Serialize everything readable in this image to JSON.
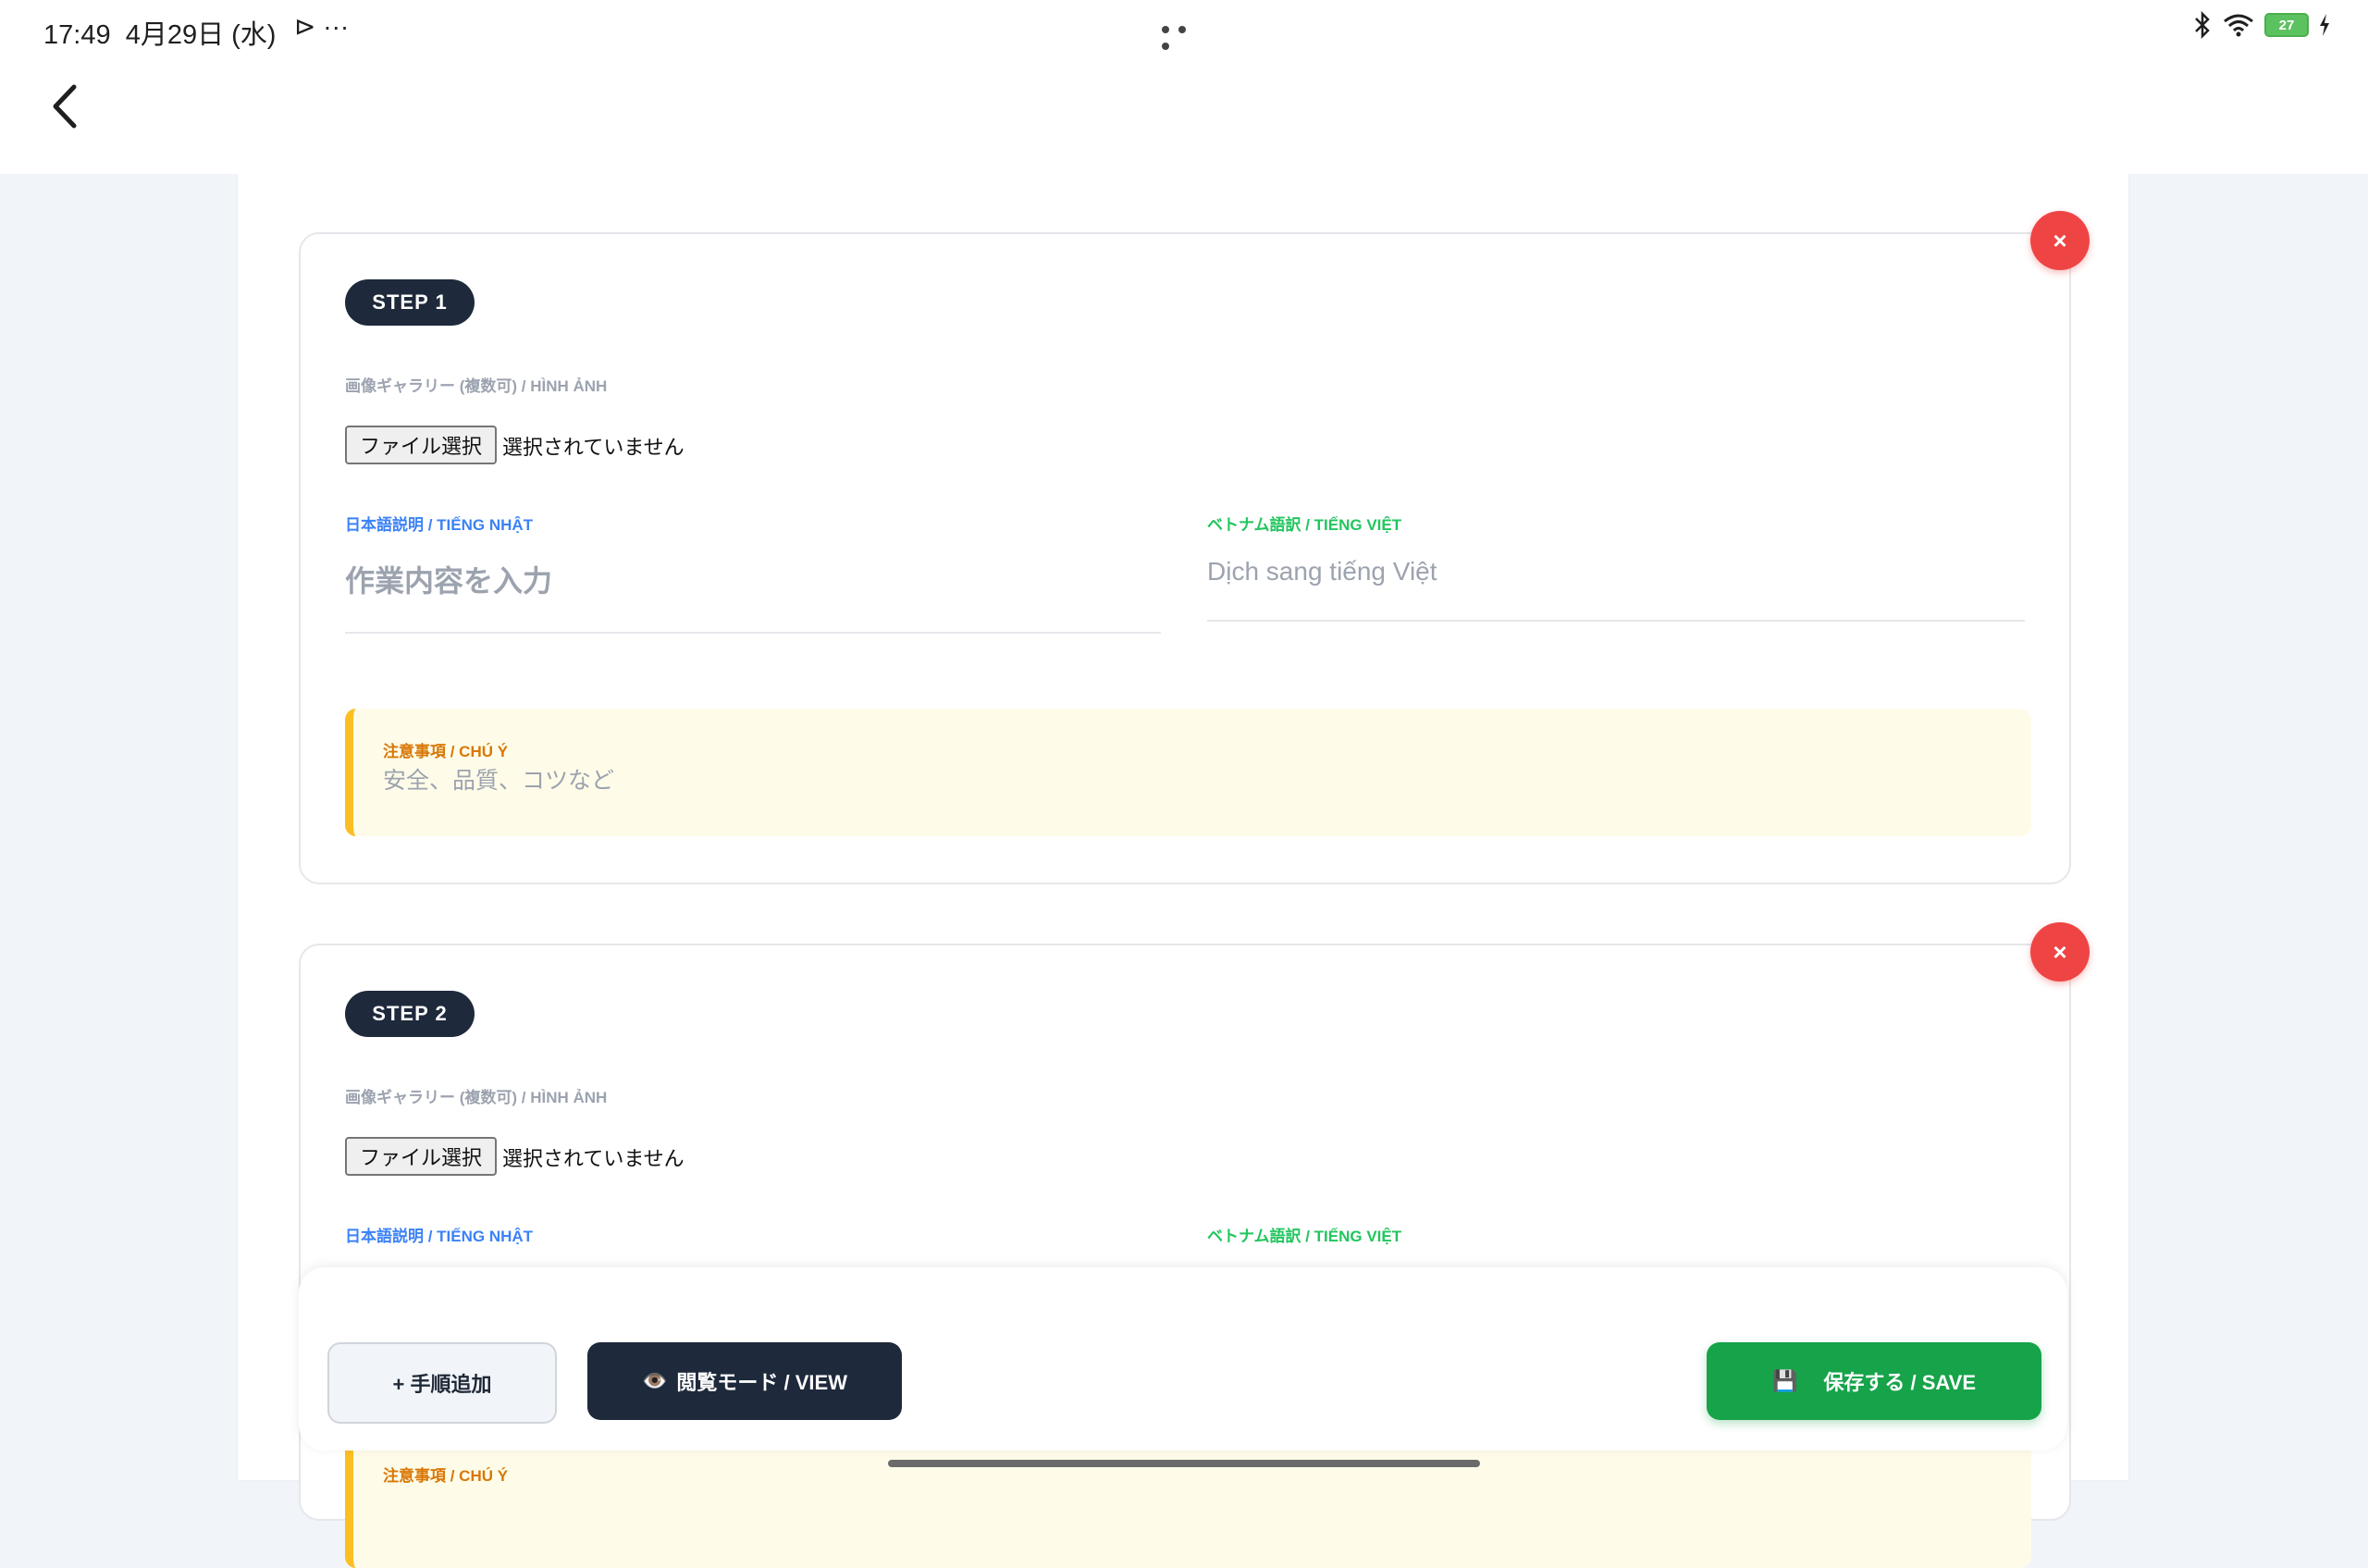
{
  "status_bar": {
    "time": "17:49",
    "date": "4月29日 (水)",
    "left_icons": "⊳ ···",
    "battery": "27"
  },
  "steps": [
    {
      "badge": "STEP 1",
      "gallery_label": "画像ギャラリー (複数可) / HÌNH ẢNH",
      "file_button": "ファイル選択",
      "file_status": "選択されていません",
      "jp_label": "日本語説明 / TIẾNG NHẬT",
      "jp_placeholder": "作業内容を入力",
      "vn_label": "ベトナム語訳 / TIẾNG VIỆT",
      "vn_placeholder": "Dịch sang tiếng Việt",
      "note_label": "注意事項 / CHÚ Ý",
      "note_placeholder": "安全、品質、コツなど",
      "close": "×"
    },
    {
      "badge": "STEP 2",
      "gallery_label": "画像ギャラリー (複数可) / HÌNH ẢNH",
      "file_button": "ファイル選択",
      "file_status": "選択されていません",
      "jp_label": "日本語説明 / TIẾNG NHẬT",
      "vn_label": "ベトナム語訳 / TIẾNG VIỆT",
      "note_label": "注意事項 / CHÚ Ý",
      "close": "×"
    }
  ],
  "actions": {
    "add_step": "+ 手順追加",
    "view_mode_icon": "👁️",
    "view_mode": "閲覧モード / VIEW",
    "save_icon": "💾",
    "save": "保存する / SAVE"
  }
}
